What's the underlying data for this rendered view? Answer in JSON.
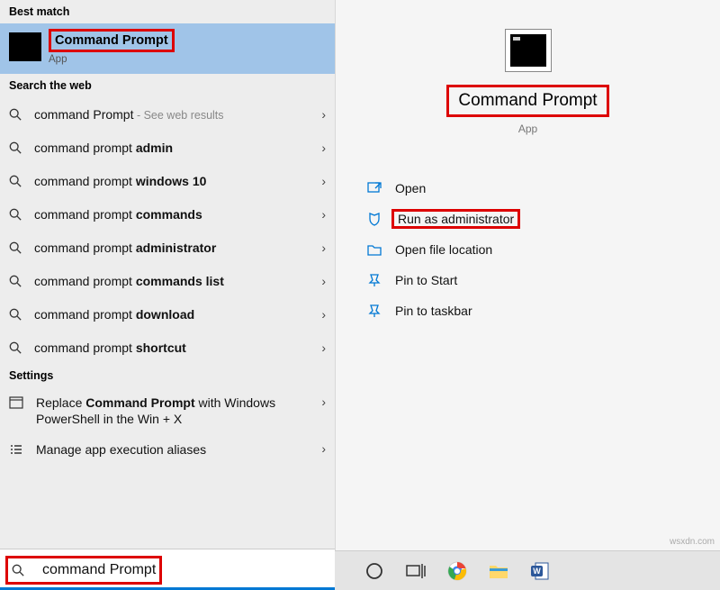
{
  "sections": {
    "best_match": "Best match",
    "search_web": "Search the web",
    "settings": "Settings"
  },
  "best_match_item": {
    "title": "Command Prompt",
    "subtitle": "App"
  },
  "web_results": [
    {
      "prefix": "command Prompt",
      "bold": "",
      "note": " - See web results"
    },
    {
      "prefix": "command prompt ",
      "bold": "admin",
      "note": ""
    },
    {
      "prefix": "command prompt ",
      "bold": "windows 10",
      "note": ""
    },
    {
      "prefix": "command prompt ",
      "bold": "commands",
      "note": ""
    },
    {
      "prefix": "command prompt ",
      "bold": "administrator",
      "note": ""
    },
    {
      "prefix": "command prompt ",
      "bold": "commands list",
      "note": ""
    },
    {
      "prefix": "command prompt ",
      "bold": "download",
      "note": ""
    },
    {
      "prefix": "command prompt ",
      "bold": "shortcut",
      "note": ""
    }
  ],
  "settings_items": [
    {
      "pre": "Replace ",
      "bold": "Command Prompt",
      "post": " with Windows PowerShell in the Win + X"
    },
    {
      "pre": "Manage app execution aliases",
      "bold": "",
      "post": ""
    }
  ],
  "search_input": "command Prompt",
  "detail": {
    "title": "Command Prompt",
    "subtitle": "App"
  },
  "actions": {
    "open": "Open",
    "run_admin": "Run as administrator",
    "open_loc": "Open file location",
    "pin_start": "Pin to Start",
    "pin_taskbar": "Pin to taskbar"
  },
  "watermark": "wsxdn.com"
}
